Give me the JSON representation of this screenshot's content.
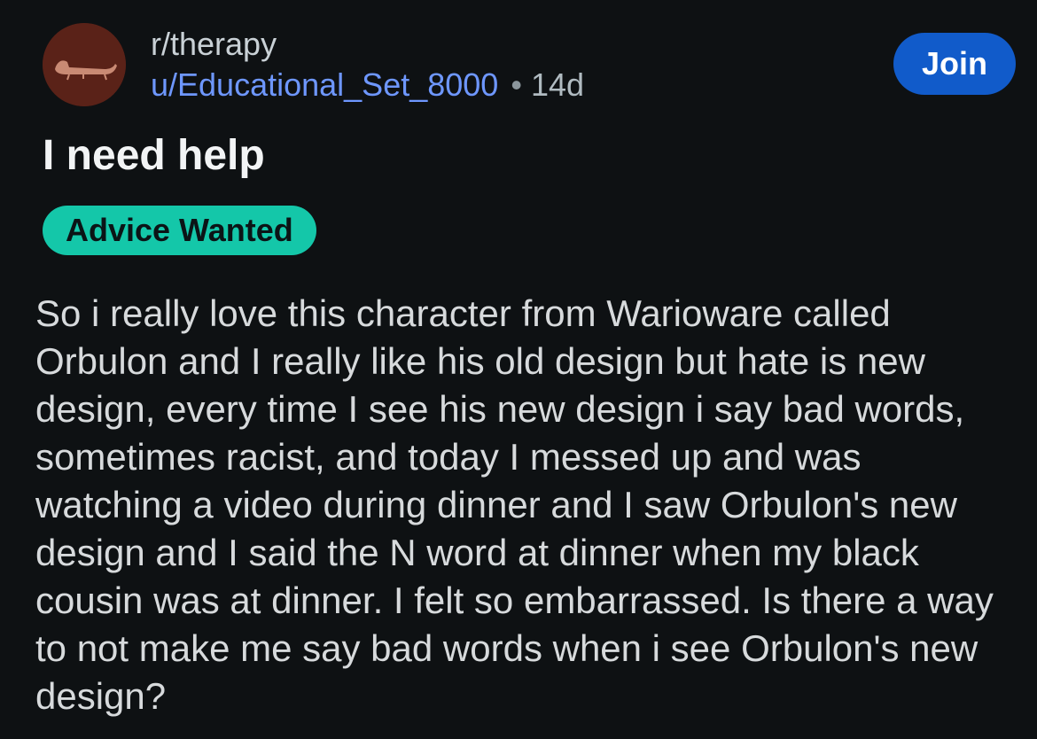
{
  "post": {
    "subreddit": "r/therapy",
    "author": "u/Educational_Set_8000",
    "separator": "•",
    "age": "14d",
    "join_label": "Join",
    "title": "I need help",
    "flair": "Advice Wanted",
    "body": "So i really love this character from Warioware called Orbulon and I really like his old design but hate is new design, every time I see his new design i say bad words, sometimes racist, and today I messed up and was watching a video during dinner and I saw Orbulon's new design and I said the N word at dinner when my black cousin was at dinner. I felt so embarrassed. Is there a way to not make me say bad words when i see Orbulon's new design?"
  },
  "icons": {
    "subreddit_avatar": "chaise-lounge-icon"
  },
  "colors": {
    "background": "#0e1113",
    "author_link": "#6e97ff",
    "join_button": "#115bca",
    "flair_background": "#14c7a9",
    "avatar_background": "#5a2218"
  }
}
